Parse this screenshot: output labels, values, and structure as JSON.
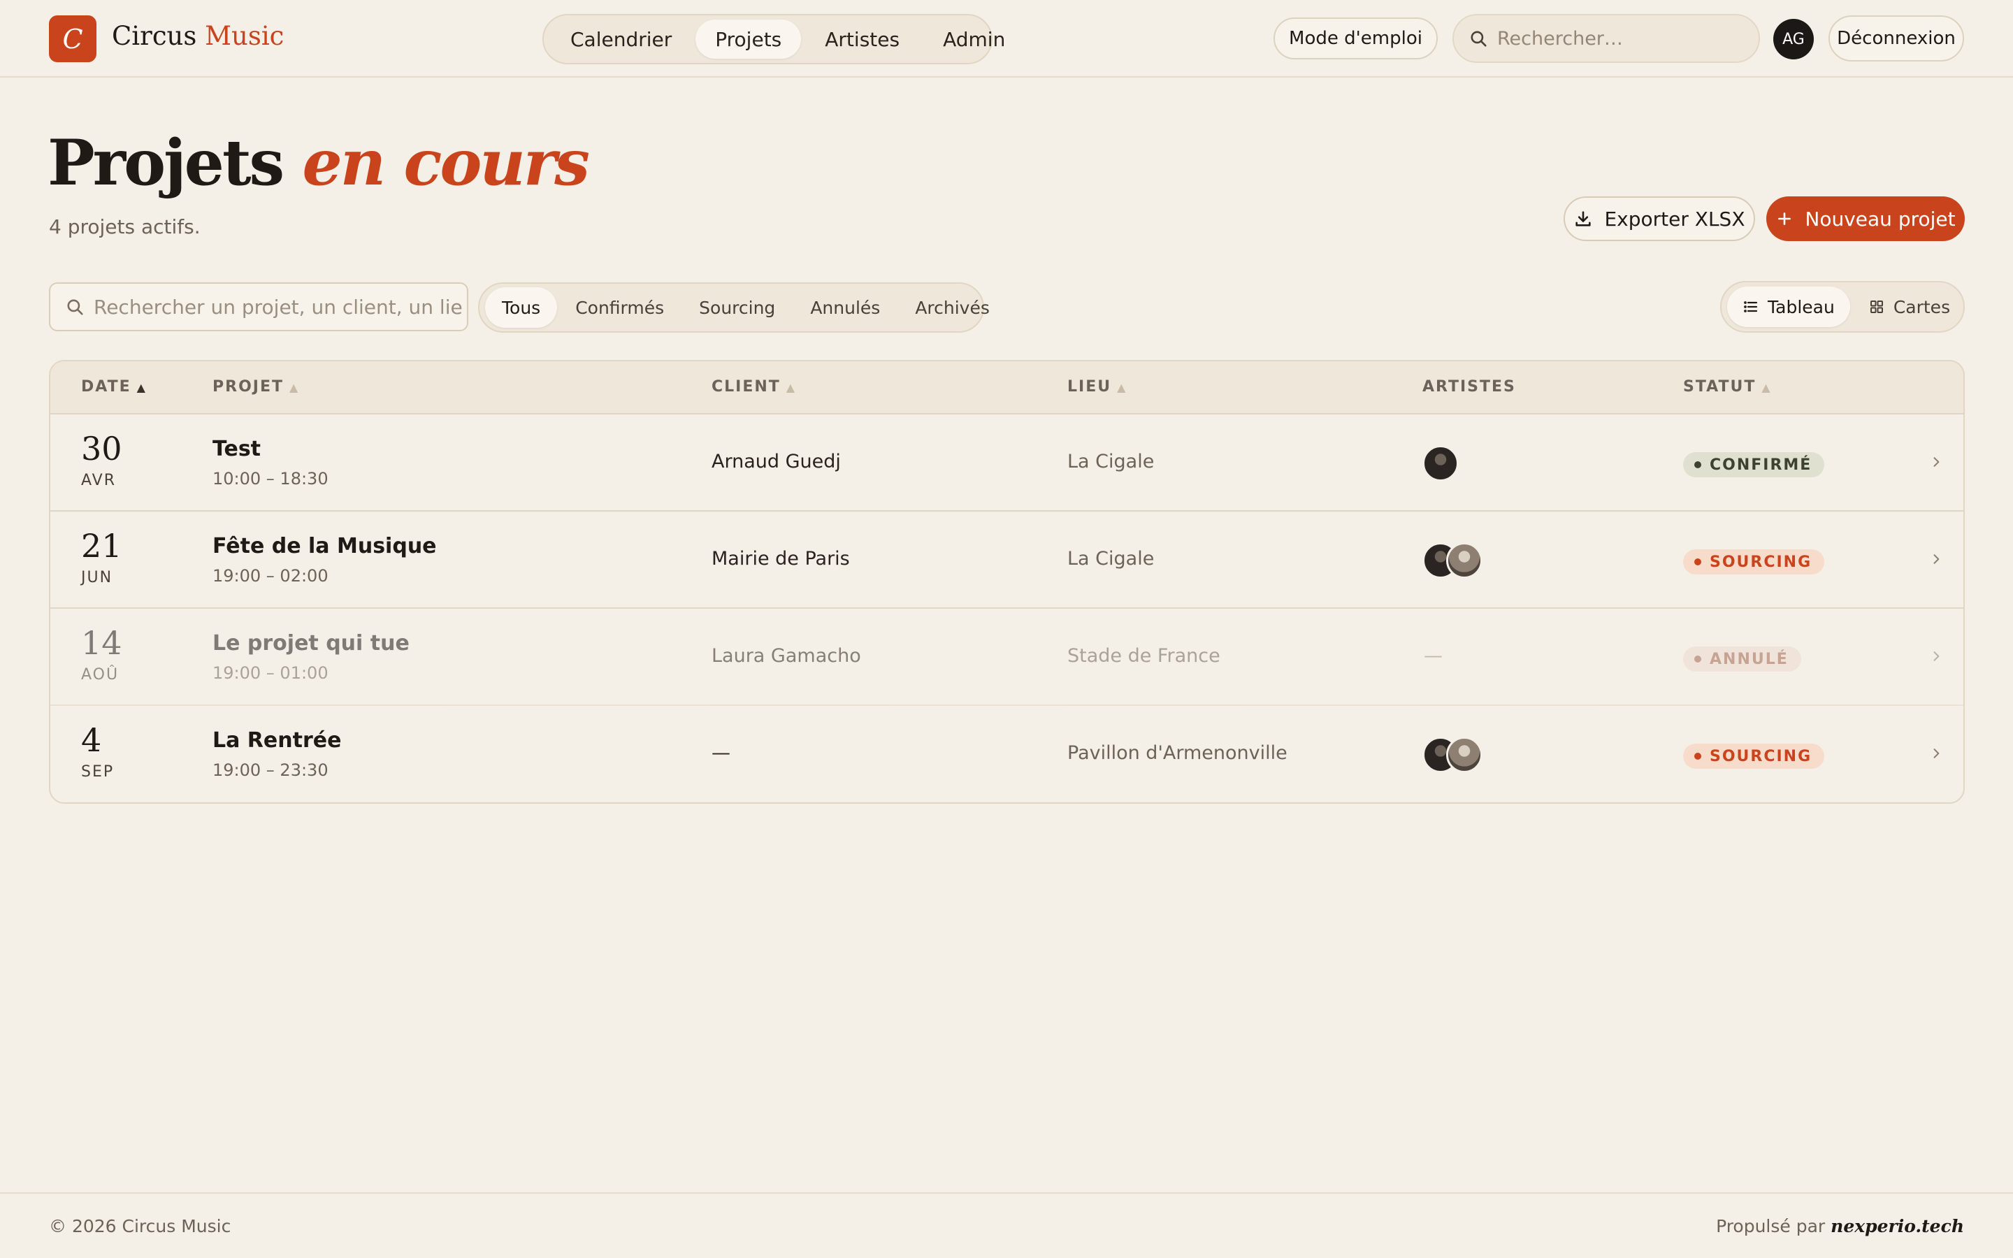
{
  "brand": {
    "logo_letter": "C",
    "name_main": "Circus",
    "name_accent": "Music",
    "accent_color": "#c9441c"
  },
  "nav": {
    "items": [
      "Calendrier",
      "Projets",
      "Artistes",
      "Admin"
    ],
    "active": "Projets"
  },
  "header": {
    "guide_label": "Mode d'emploi",
    "search_placeholder": "Rechercher…",
    "user_initials": "AG",
    "logout_label": "Déconnexion"
  },
  "page": {
    "title_main": "Projets",
    "title_accent": "en cours",
    "subtitle": "4 projets actifs.",
    "export_label": "Exporter XLSX",
    "new_label": "Nouveau projet"
  },
  "filters": {
    "search_placeholder": "Rechercher un projet, un client, un lieu…",
    "tabs": [
      "Tous",
      "Confirmés",
      "Sourcing",
      "Annulés",
      "Archivés"
    ],
    "active_tab": "Tous",
    "views": [
      "Tableau",
      "Cartes"
    ],
    "active_view": "Tableau"
  },
  "table": {
    "columns": [
      "DATE",
      "PROJET",
      "CLIENT",
      "LIEU",
      "ARTISTES",
      "STATUT"
    ],
    "sort_column": "DATE",
    "rows": [
      {
        "day": "30",
        "month": "AVR",
        "name": "Test",
        "time": "10:00 – 18:30",
        "client": "Arnaud Guedj",
        "venue": "La Cigale",
        "artists": "1 artist",
        "artists_text": "",
        "status": "CONFIRMÉ",
        "status_type": "confirmed"
      },
      {
        "day": "21",
        "month": "JUN",
        "name": "Fête de la Musique",
        "time": "19:00 – 02:00",
        "client": "Mairie de Paris",
        "venue": "La Cigale",
        "artists": "2 artists",
        "artists_text": "",
        "status": "SOURCING",
        "status_type": "sourcing"
      },
      {
        "day": "14",
        "month": "AOÛ",
        "name": "Le projet qui tue",
        "time": "19:00 – 01:00",
        "client": "Laura Gamacho",
        "venue": "Stade de France",
        "artists": "none",
        "artists_text": "—",
        "status": "ANNULÉ",
        "status_type": "cancelled"
      },
      {
        "day": "4",
        "month": "SEP",
        "name": "La Rentrée",
        "time": "19:00 – 23:30",
        "client": "—",
        "venue": "Pavillon d'Armenonville",
        "artists": "2 artists",
        "artists_text": "",
        "status": "SOURCING",
        "status_type": "sourcing"
      }
    ]
  },
  "footer": {
    "copyright": "© 2026 Circus Music",
    "powered_prefix": "Propulsé par",
    "powered_brand": "nexperio.tech"
  }
}
